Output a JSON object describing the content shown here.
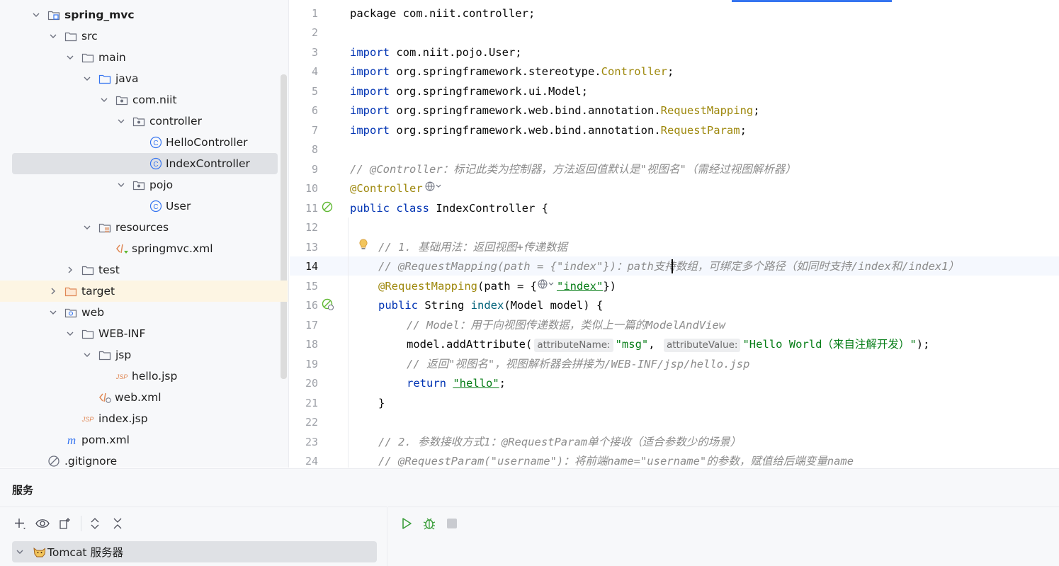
{
  "project_tree": {
    "items": [
      {
        "label": "spring_mvc",
        "icon": "module-folder-icon",
        "expanded": true
      },
      {
        "label": "src",
        "icon": "folder-icon",
        "expanded": true
      },
      {
        "label": "main",
        "icon": "folder-icon",
        "expanded": true
      },
      {
        "label": "java",
        "icon": "source-folder-icon",
        "expanded": true
      },
      {
        "label": "com.niit",
        "icon": "package-icon",
        "expanded": true
      },
      {
        "label": "controller",
        "icon": "package-icon",
        "expanded": true
      },
      {
        "label": "HelloController",
        "icon": "class-icon"
      },
      {
        "label": "IndexController",
        "icon": "class-icon",
        "selected": true
      },
      {
        "label": "pojo",
        "icon": "package-icon",
        "expanded": true
      },
      {
        "label": "User",
        "icon": "class-icon"
      },
      {
        "label": "resources",
        "icon": "resources-folder-icon",
        "expanded": true
      },
      {
        "label": "springmvc.xml",
        "icon": "xml-file-icon"
      },
      {
        "label": "test",
        "icon": "folder-icon",
        "expanded": false
      },
      {
        "label": "target",
        "icon": "excluded-folder-icon",
        "expanded": false
      },
      {
        "label": "web",
        "icon": "web-folder-icon",
        "expanded": true
      },
      {
        "label": "WEB-INF",
        "icon": "folder-icon",
        "expanded": true
      },
      {
        "label": "jsp",
        "icon": "folder-icon",
        "expanded": true
      },
      {
        "label": "hello.jsp",
        "icon": "jsp-file-icon"
      },
      {
        "label": "web.xml",
        "icon": "web-xml-icon"
      },
      {
        "label": "index.jsp",
        "icon": "jsp-file-icon"
      },
      {
        "label": "pom.xml",
        "icon": "maven-icon"
      },
      {
        "label": ".gitignore",
        "icon": "ignored-file-icon"
      }
    ]
  },
  "editor": {
    "current_line": 14,
    "line_numbers": [
      "1",
      "2",
      "3",
      "4",
      "5",
      "6",
      "7",
      "8",
      "9",
      "10",
      "11",
      "12",
      "13",
      "14",
      "15",
      "16",
      "17",
      "18",
      "19",
      "20",
      "21",
      "22",
      "23",
      "24"
    ],
    "code": {
      "l1": "package com.niit.controller;",
      "l3_kw": "import",
      "l3_rest": " com.niit.pojo.User;",
      "l4_kw": "import",
      "l4_rest": " org.springframework.stereotype.",
      "l4_an": "Controller",
      "l4_end": ";",
      "l5_kw": "import",
      "l5_rest": " org.springframework.ui.Model;",
      "l6_kw": "import",
      "l6_rest": " org.springframework.web.bind.annotation.",
      "l6_an": "RequestMapping",
      "l6_end": ";",
      "l7_kw": "import",
      "l7_rest": " org.springframework.web.bind.annotation.",
      "l7_an": "RequestParam",
      "l7_end": ";",
      "l9": "// @Controller：标记此类为控制器，方法返回值默认是\"视图名\"（需经过视图解析器）",
      "l10": "@Controller",
      "l11_kw": "public class",
      "l11_rest": " IndexController {",
      "l13": "// 1. 基础用法：返回视图+传递数据",
      "l14_a": "// @RequestMapping(path = {\"index\"})：path",
      "l14_b": "支持数组，可绑定多个路径（如同时支持/index和/index1）",
      "l15_an": "@RequestMapping",
      "l15_a": "(path = {",
      "l15_str": "\"index\"",
      "l15_end": "})",
      "l16_kw": "public",
      "l16_a": " String ",
      "l16_fn": "index",
      "l16_b": "(Model model) {",
      "l17": "// Model：用于向视图传递数据，类似上一篇的ModelAndView",
      "l18_a": "model.addAttribute(",
      "l18_hint1": "attributeName:",
      "l18_str1": "\"msg\"",
      "l18_comma": ",",
      "l18_hint2": "attributeValue:",
      "l18_str2": "\"Hello World（来自注解开发）\"",
      "l18_end": ");",
      "l19": "// 返回\"视图名\"，视图解析器会拼接为/WEB-INF/jsp/hello.jsp",
      "l20_kw": "return",
      "l20_str": "\"hello\"",
      "l20_end": ";",
      "l21": "}",
      "l23": "// 2. 参数接收方式1：@RequestParam单个接收（适合参数少的场景）",
      "l24": "// @RequestParam(\"username\")：将前端name=\"username\"的参数，赋值给后端变量name"
    }
  },
  "services": {
    "title": "服务",
    "toolbar": [
      "add-icon",
      "eye-icon",
      "new-group-icon",
      "expand-all-icon",
      "collapse-all-icon"
    ],
    "run_toolbar": [
      "run-icon",
      "debug-icon",
      "stop-icon"
    ],
    "tomcat_label": "Tomcat 服务器"
  },
  "colors": {
    "accent": "#3574f0",
    "keyword": "#0033b3",
    "annotation": "#9e880d",
    "comment": "#8c8c8c",
    "string": "#067d17",
    "selection": "#dfe1e5"
  }
}
